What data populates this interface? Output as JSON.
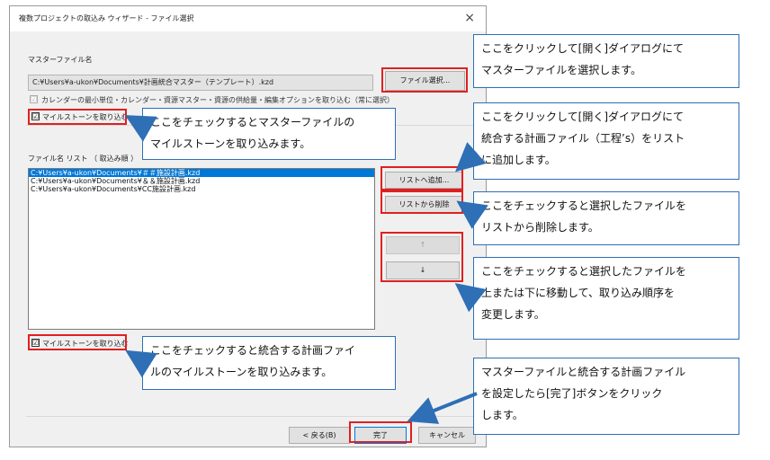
{
  "window": {
    "title": "複数プロジェクトの取込み ウィザード - ファイル選択",
    "close_glyph": "×"
  },
  "master": {
    "section_label": "マスターファイル名",
    "path": "C:¥Users¥a-ukon¥Documents¥計画統合マスター（テンプレート）.kzd",
    "select_button": "ファイル選択...",
    "calendar_option": "カレンダーの最小単位・カレンダー・資源マスター・資源の供給量・編集オプションを取り込む（常に選択）",
    "milestone_checkbox": "マイルストーンを取り込む",
    "check_glyph": "☑"
  },
  "filelist": {
    "label": "ファイル名 リスト （ 取込み順 ）",
    "items": [
      "C:¥Users¥a-ukon¥Documents¥＃＃施設計画.kzd",
      "C:¥Users¥a-ukon¥Documents¥＆＆施設計画.kzd",
      "C:¥Users¥a-ukon¥Documents¥CC施設計画.kzd"
    ],
    "add_button": "リストへ追加...",
    "remove_button": "リストから削除",
    "up_glyph": "↑",
    "down_glyph": "↓",
    "milestone_checkbox": "マイルストーンを取り込む"
  },
  "footer": {
    "back_button": "< 戻る(B)",
    "finish_button": "完了",
    "cancel_button": "キャンセル"
  },
  "callouts": {
    "select_file": [
      "ここをクリックして[開く]ダイアログにて",
      "マスターファイルを選択します。"
    ],
    "master_milestone": [
      "ここをチェックするとマスターファイルの",
      "マイルストーンを取り込みます。"
    ],
    "add_list": [
      "ここをクリックして[開く]ダイアログにて",
      "統合する計画ファイル（工程’s）をリスト",
      "に追加します。"
    ],
    "remove": [
      "ここをチェックすると選択したファイルを",
      "リストから削除します。"
    ],
    "move": [
      "ここをチェックすると選択したファイルを",
      "上または下に移動して、取り込み順序を",
      "変更します。"
    ],
    "list_milestone": [
      "ここをチェックすると統合する計画ファイ",
      "ルのマイルストーンを取り込みます。"
    ],
    "finish": [
      "マスターファイルと統合する計画ファイル",
      "を設定したら[完了]ボタンをクリック",
      "します。"
    ]
  },
  "colors": {
    "highlight_red": "#e02020",
    "callout_blue": "#2e6fb5",
    "selection_blue": "#0078d7"
  }
}
